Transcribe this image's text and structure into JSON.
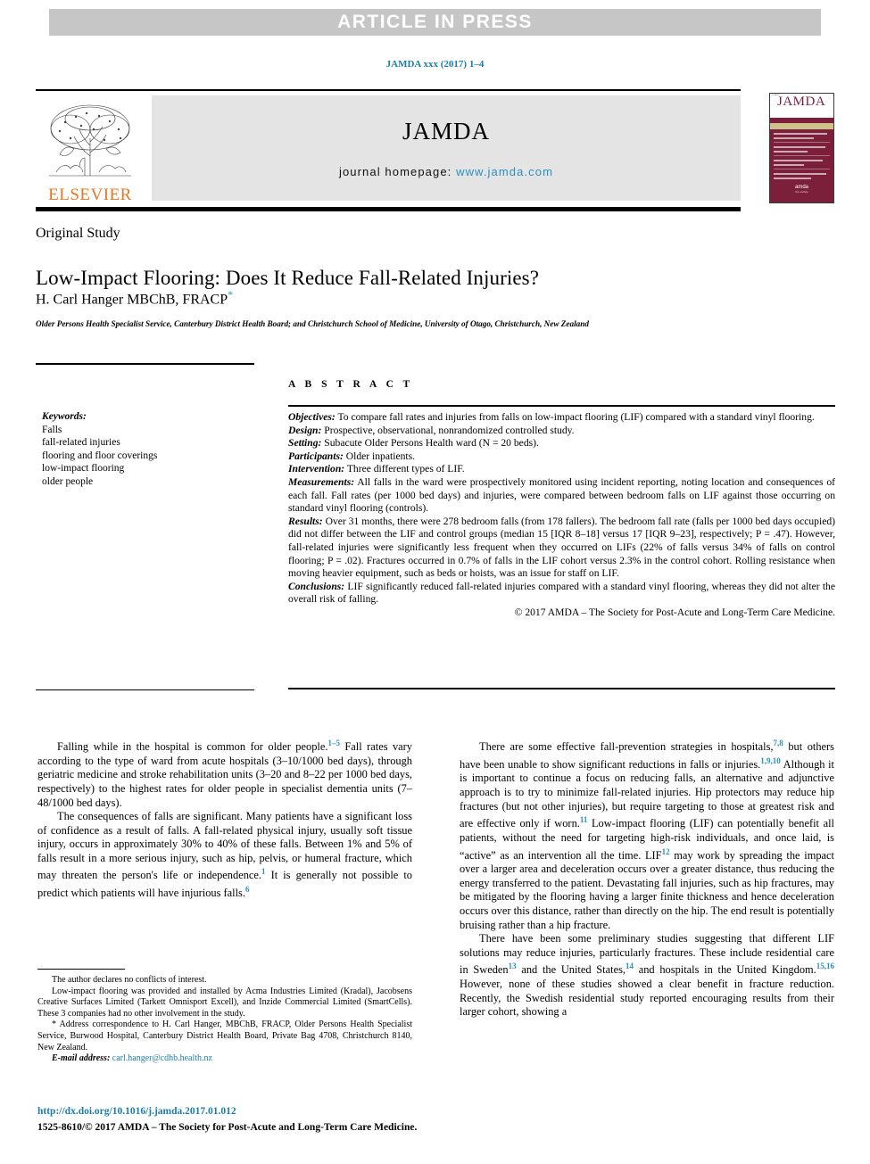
{
  "banner": {
    "text": "ARTICLE IN PRESS"
  },
  "citation": {
    "text": "JAMDA xxx (2017) 1–4"
  },
  "masthead": {
    "publisher": "ELSEVIER",
    "journal_title": "JAMDA",
    "homepage_label": "journal homepage:",
    "homepage_url": "www.jamda.com",
    "cover_title": "JAMDA"
  },
  "article": {
    "type": "Original Study",
    "title": "Low-Impact Flooring: Does It Reduce Fall-Related Injuries?",
    "author": "H. Carl Hanger MBChB, FRACP",
    "author_marker": "*",
    "affiliation": "Older Persons Health Specialist Service, Canterbury District Health Board; and Christchurch School of Medicine, University of Otago, Christchurch, New Zealand"
  },
  "keywords": {
    "heading": "Keywords:",
    "items": [
      "Falls",
      "fall-related injuries",
      "flooring and floor coverings",
      "low-impact flooring",
      "older people"
    ]
  },
  "abstract": {
    "heading": "A B S T R A C T",
    "objectives_label": "Objectives:",
    "objectives": " To compare fall rates and injuries from falls on low-impact flooring (LIF) compared with a standard vinyl flooring.",
    "design_label": "Design:",
    "design": " Prospective, observational, nonrandomized controlled study.",
    "setting_label": "Setting:",
    "setting": " Subacute Older Persons Health ward (N = 20 beds).",
    "participants_label": "Participants:",
    "participants": " Older inpatients.",
    "intervention_label": "Intervention:",
    "intervention": " Three different types of LIF.",
    "measurements_label": "Measurements:",
    "measurements": " All falls in the ward were prospectively monitored using incident reporting, noting location and consequences of each fall. Fall rates (per 1000 bed days) and injuries, were compared between bedroom falls on LIF against those occurring on standard vinyl flooring (controls).",
    "results_label": "Results:",
    "results": " Over 31 months, there were 278 bedroom falls (from 178 fallers). The bedroom fall rate (falls per 1000 bed days occupied) did not differ between the LIF and control groups (median 15 [IQR 8–18] versus 17 [IQR 9–23], respectively; P = .47). However, fall-related injuries were significantly less frequent when they occurred on LIFs (22% of falls versus 34% of falls on control flooring; P = .02). Fractures occurred in 0.7% of falls in the LIF cohort versus 2.3% in the control cohort. Rolling resistance when moving heavier equipment, such as beds or hoists, was an issue for staff on LIF.",
    "conclusions_label": "Conclusions:",
    "conclusions": " LIF significantly reduced fall-related injuries compared with a standard vinyl flooring, whereas they did not alter the overall risk of falling.",
    "copyright": "© 2017 AMDA – The Society for Post-Acute and Long-Term Care Medicine."
  },
  "body": {
    "left": [
      {
        "segments": [
          {
            "t": "Falling while in the hospital is common for older people."
          },
          {
            "t": "1–5",
            "ref": true
          },
          {
            "t": " Fall rates vary according to the type of ward from acute hospitals (3–10/1000 bed days), through geriatric medicine and stroke rehabilitation units (3–20 and 8–22 per 1000 bed days, respectively) to the highest rates for older people in specialist dementia units (7–48/1000 bed days)."
          }
        ]
      },
      {
        "segments": [
          {
            "t": "The consequences of falls are significant. Many patients have a significant loss of confidence as a result of falls. A fall-related physical injury, usually soft tissue injury, occurs in approximately 30% to 40% of these falls. Between 1% and 5% of falls result in a more serious injury, such as hip, pelvis, or humeral fracture, which may threaten the person's life or independence."
          },
          {
            "t": "1",
            "ref": true
          },
          {
            "t": " It is generally not possible to predict which patients will have injurious falls."
          },
          {
            "t": "6",
            "ref": true
          }
        ]
      }
    ],
    "right": [
      {
        "segments": [
          {
            "t": "There are some effective fall-prevention strategies in hospitals,"
          },
          {
            "t": "7,8",
            "ref": true
          },
          {
            "t": " but others have been unable to show significant reductions in falls or injuries."
          },
          {
            "t": "1,9,10",
            "ref": true
          },
          {
            "t": " Although it is important to continue a focus on reducing falls, an alternative and adjunctive approach is to try to minimize fall-related injuries. Hip protectors may reduce hip fractures (but not other injuries), but require targeting to those at greatest risk and are effective only if worn."
          },
          {
            "t": "11",
            "ref": true
          },
          {
            "t": " Low-impact flooring (LIF) can potentially benefit all patients, without the need for targeting high-risk individuals, and once laid, is “active” as an intervention all the time. LIF"
          },
          {
            "t": "12",
            "ref": true
          },
          {
            "t": " may work by spreading the impact over a larger area and deceleration occurs over a greater distance, thus reducing the energy transferred to the patient. Devastating fall injuries, such as hip fractures, may be mitigated by the flooring having a larger finite thickness and hence deceleration occurs over this distance, rather than directly on the hip. The end result is potentially bruising rather than a hip fracture."
          }
        ]
      },
      {
        "segments": [
          {
            "t": "There have been some preliminary studies suggesting that different LIF solutions may reduce injuries, particularly fractures. These include residential care in Sweden"
          },
          {
            "t": "13",
            "ref": true
          },
          {
            "t": " and the United States,"
          },
          {
            "t": "14",
            "ref": true
          },
          {
            "t": " and hospitals in the United Kingdom."
          },
          {
            "t": "15,16",
            "ref": true
          },
          {
            "t": " However, none of these studies showed a clear benefit in fracture reduction. Recently, the Swedish residential study reported encouraging results from their larger cohort, showing a"
          }
        ]
      }
    ]
  },
  "footnotes": {
    "conflict": "The author declares no conflicts of interest.",
    "funding": "Low-impact flooring was provided and installed by Acma Industries Limited (Kradal), Jacobsens Creative Surfaces Limited (Tarkett Omnisport Excell), and Inzide Commercial Limited (SmartCells). These 3 companies had no other involvement in the study.",
    "correspondence_marker": "*",
    "correspondence": " Address correspondence to H. Carl Hanger, MBChB, FRACP, Older Persons Health Specialist Service, Burwood Hospital, Canterbury District Health Board, Private Bag 4708, Christchurch 8140, New Zealand.",
    "email_label": "E-mail address:",
    "email": "carl.hanger@cdhb.health.nz"
  },
  "footer": {
    "doi": "http://dx.doi.org/10.1016/j.jamda.2017.01.012",
    "issn_copyright": "1525-8610/© 2017 AMDA – The Society for Post-Acute and Long-Term Care Medicine."
  },
  "colors": {
    "banner_bg": "#c6c6c6",
    "link": "#1a7ea8",
    "accent_blue": "#2a8fc0",
    "elsevier_orange": "#e87722",
    "cover_maroon": "#7b1f3a",
    "masthead_band": "#e4e4e4"
  }
}
